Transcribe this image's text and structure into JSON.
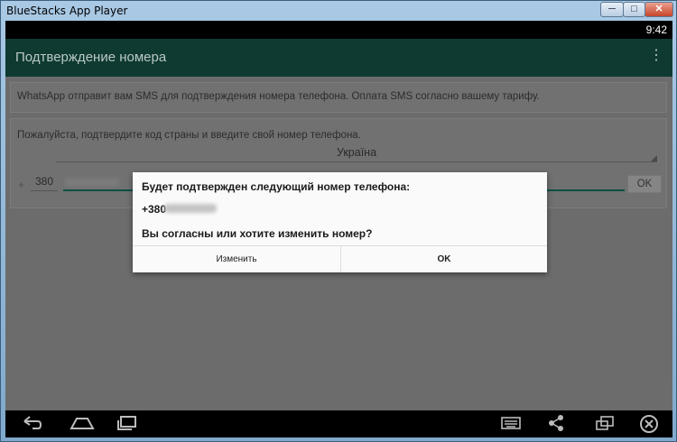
{
  "window": {
    "title": "BlueStacks App Player",
    "min_label": "─",
    "max_label": "□",
    "close_label": "✕"
  },
  "status": {
    "time": "9:42"
  },
  "appbar": {
    "title": "Подтверждение номера",
    "overflow_glyph": "⋮"
  },
  "card1": {
    "text": "WhatsApp отправит вам SMS для подтверждения номера телефона. Оплата SMS согласно вашему тарифу."
  },
  "card2": {
    "prompt": "Пожалуйста, подтвердите код страны и введите свой номер телефона.",
    "country": "Україна",
    "plus": "+",
    "code": "380",
    "ok_label": "OK"
  },
  "dialog": {
    "message": "Будет подтвержден следующий номер телефона:",
    "number_prefix": "+380",
    "question": "Вы согласны или хотите изменить номер?",
    "change_label": "Изменить",
    "ok_label": "OK"
  },
  "nav": {
    "back_icon": "back-icon",
    "home_icon": "home-icon",
    "recents_icon": "recents-icon",
    "keyboard_icon": "keyboard-icon",
    "share_icon": "share-icon",
    "window_icon": "window-icon",
    "close_icon": "close-circle-icon"
  }
}
